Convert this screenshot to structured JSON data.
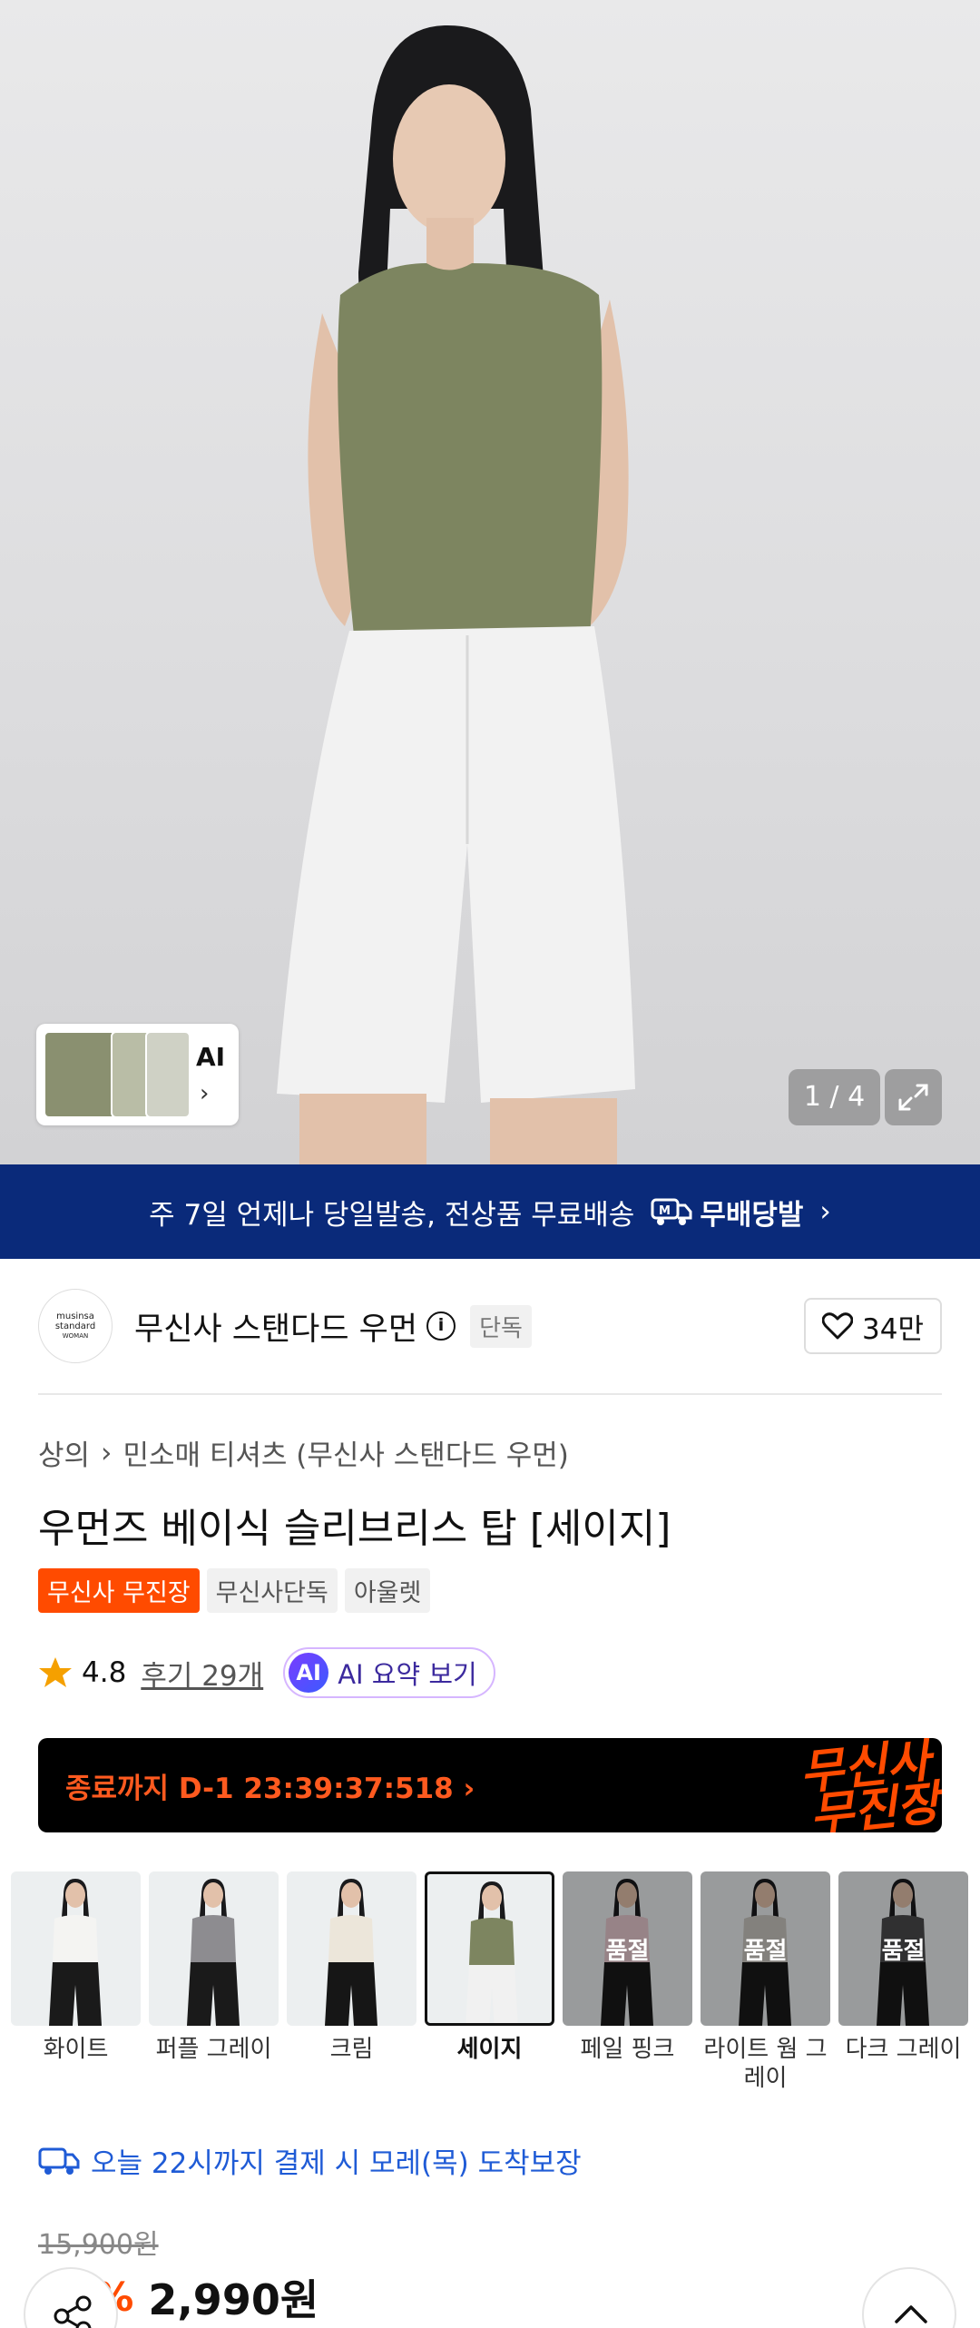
{
  "gallery": {
    "counter": "1 / 4",
    "thumb_label": "AI",
    "thumb_chevron": "›"
  },
  "banner": {
    "text": "주 7일 언제나 당일발송, 전상품 무료배송",
    "service_name": "무배당발",
    "chevron": "›"
  },
  "brand": {
    "logo_lines": [
      "musinsa",
      "standard",
      "WOMAN"
    ],
    "name": "무신사 스탠다드 우먼",
    "info_glyph": "i",
    "exclusive_badge": "단독",
    "likes": "34만"
  },
  "product": {
    "breadcrumb": [
      "상의",
      "민소매 티셔츠 (무신사 스탠다드 우먼)"
    ],
    "breadcrumb_sep": "›",
    "title": "우먼즈 베이식 슬리브리스 탑 [세이지]",
    "tags": [
      "무신사 무진장",
      "무신사단독",
      "아울렛"
    ],
    "rating": "4.8",
    "reviews": "후기 29개",
    "ai_badge": "AI",
    "ai_summary": "AI 요약 보기"
  },
  "timer": {
    "text": "종료까지 D-1 23:39:37:518 ›",
    "logo_line1": "무신사",
    "logo_line2": "무진장"
  },
  "colors": {
    "sold_out": "품절",
    "items": [
      {
        "label": "화이트",
        "top": "#f4f4f2",
        "bottom": "#1a1a1a",
        "sold_out": false,
        "selected": false
      },
      {
        "label": "퍼플 그레이",
        "top": "#8d8c90",
        "bottom": "#1a1a1a",
        "sold_out": false,
        "selected": false
      },
      {
        "label": "크림",
        "top": "#ece6da",
        "bottom": "#161616",
        "sold_out": false,
        "selected": false
      },
      {
        "label": "세이지",
        "top": "#7d8560",
        "bottom": "#f1f1f1",
        "sold_out": false,
        "selected": true
      },
      {
        "label": "페일 핑크",
        "top": "#e8c9cf",
        "bottom": "#1a1a1a",
        "sold_out": true,
        "selected": false
      },
      {
        "label": "라이트 웜 그레이",
        "top": "#c9c6c0",
        "bottom": "#1a1a1a",
        "sold_out": true,
        "selected": false
      },
      {
        "label": "다크 그레이",
        "top": "#4a4a4c",
        "bottom": "#1a1a1a",
        "sold_out": true,
        "selected": false
      }
    ]
  },
  "delivery": {
    "arrival": "오늘 22시까지 결제 시 모레(목) 도착보장"
  },
  "price": {
    "original": "15,900원",
    "discount": "81%",
    "current": "2,990원"
  },
  "theme": {
    "accent": "#ff4b00",
    "banner_bg": "#0a2a7a",
    "link_blue": "#1f5bd6"
  }
}
